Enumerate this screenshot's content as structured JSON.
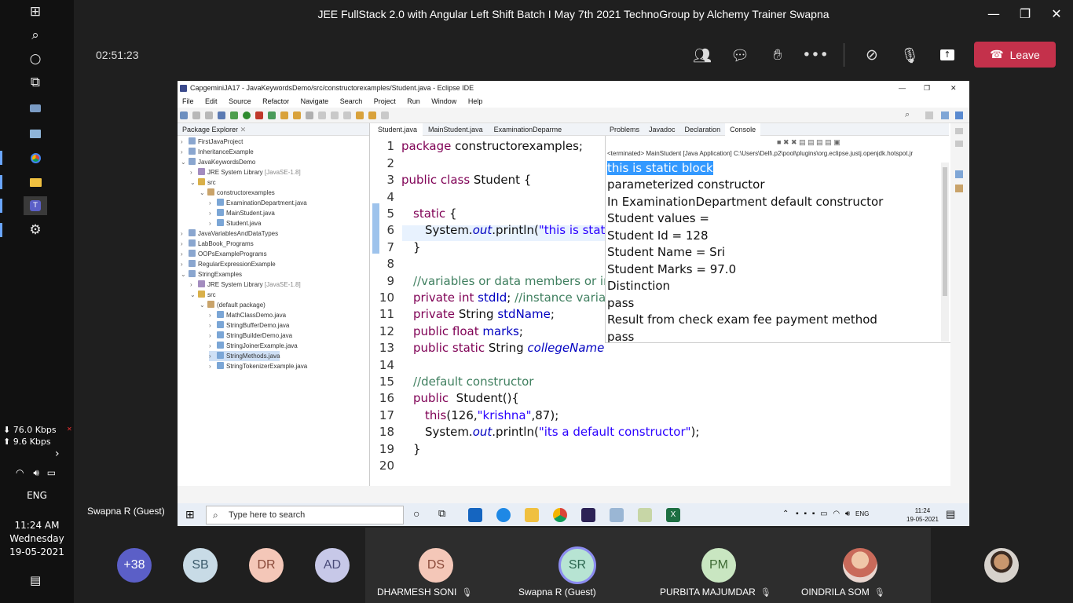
{
  "teams": {
    "title": "JEE FullStack 2.0 with Angular Left Shift Batch I May 7th 2021 TechnoGroup by Alchemy Trainer Swapna",
    "timer": "02:51:23",
    "leave_label": "Leave",
    "presenter": "Swapna R (Guest)",
    "accent": "#c4314b"
  },
  "system": {
    "net_down": "⬇ 76.0 Kbps",
    "net_up": "⬆ 9.6 Kbps",
    "language": "ENG",
    "time": "11:24 AM",
    "day": "Wednesday",
    "date": "19-05-2021"
  },
  "eclipse": {
    "title": "CapgeminiJA17 - JavaKeywordsDemo/src/constructorexamples/Student.java - Eclipse IDE",
    "menu": [
      "File",
      "Edit",
      "Source",
      "Refactor",
      "Navigate",
      "Search",
      "Project",
      "Run",
      "Window",
      "Help"
    ],
    "package_explorer_tab": "Package Explorer",
    "tree": [
      {
        "label": "FirstJavaProject"
      },
      {
        "label": "InheritanceExample"
      },
      {
        "label": "JavaKeywordsDemo"
      },
      {
        "label": "JRE System Library",
        "dim": "[JavaSE-1.8]"
      },
      {
        "label": "src"
      },
      {
        "label": "constructorexamples"
      },
      {
        "label": "ExaminationDepartment.java"
      },
      {
        "label": "MainStudent.java"
      },
      {
        "label": "Student.java"
      },
      {
        "label": "JavaVariablesAndDataTypes"
      },
      {
        "label": "LabBook_Programs"
      },
      {
        "label": "OOPsExamplePrograms"
      },
      {
        "label": "RegularExpressionExample"
      },
      {
        "label": "StringExamples"
      },
      {
        "label": "JRE System Library",
        "dim": "[JavaSE-1.8]"
      },
      {
        "label": "src"
      },
      {
        "label": "(default package)"
      },
      {
        "label": "MathClassDemo.java"
      },
      {
        "label": "StringBufferDemo.java"
      },
      {
        "label": "StringBuilderDemo.java"
      },
      {
        "label": "StringJoinerExample.java"
      },
      {
        "label": "StringMethods.java"
      },
      {
        "label": "StringTokenizerExample.java"
      }
    ],
    "editor_tabs": [
      "Student.java",
      "MainStudent.java",
      "ExaminationDeparme"
    ],
    "view_tabs": [
      "Problems",
      "Javadoc",
      "Declaration",
      "Console"
    ],
    "console_header": "<terminated> MainStudent [Java Application] C:\\Users\\Dell\\.p2\\pool\\plugins\\org.eclipse.justj.openjdk.hotspot.jr",
    "console_lines": [
      "this is static block",
      "parameterized constructor",
      "In ExaminationDepartment default constructor",
      "Student values =",
      "Student Id = 128",
      "Student Name = Sri",
      "Student Marks = 97.0",
      "Distinction",
      "pass",
      "Result from check exam fee payment method",
      "pass"
    ],
    "line_numbers": [
      "1",
      "2",
      "3",
      "4",
      "5",
      "6",
      "7",
      "8",
      "9",
      "10",
      "11",
      "12",
      "13",
      "14",
      "15",
      "16",
      "17",
      "18",
      "19",
      "20"
    ],
    "code": {
      "l1_kw": "package",
      "l1_rest": " constructorexamples;",
      "l3_kw": "public class",
      "l3_rest": " Student {",
      "l5_kw": "static",
      "l5_rest": " {",
      "l6_a": "System.",
      "l6_b": "out",
      "l6_c": ".println(",
      "l6_d": "\"this is stat",
      "l7": "}",
      "l9": "//variables or data members or in",
      "l10_kw": "private int",
      "l10_f": " stdId",
      "l10_p": ";",
      "l10_c": " //instance varia",
      "l11_kw": "private",
      "l11_t": " String",
      "l11_f": " stdName",
      "l11_p": ";",
      "l12_kw": "public float",
      "l12_f": " marks",
      "l12_p": ";",
      "l13_kw": "public static",
      "l13_t": " String ",
      "l13_f": "collegeName",
      "l15": "//default constructor",
      "l16_kw": "public",
      "l16_rest": "  Student(){",
      "l17_kw": "this",
      "l17_a": "(126,",
      "l17_s": "\"krishna\"",
      "l17_b": ",87);",
      "l18_a": "System.",
      "l18_b": "out",
      "l18_c": ".println(",
      "l18_s": "\"its a default constructor\"",
      "l18_d": ");",
      "l19": "}"
    }
  },
  "windows_taskbar": {
    "search_placeholder": "Type here to search",
    "lang": "ENG",
    "time": "11:24",
    "date": "19-05-2021"
  },
  "participants": [
    {
      "initials": "+38",
      "color": "#5b5fc7"
    },
    {
      "initials": "SB",
      "color": "#c8dbe6"
    },
    {
      "initials": "DR",
      "color": "#f4c7b8"
    },
    {
      "initials": "AD",
      "color": "#c7c8e8"
    },
    {
      "initials": "DS",
      "name": "DHARMESH SONI",
      "color": "#f4c7b8"
    },
    {
      "initials": "SR",
      "name": "Swapna R (Guest)",
      "color": "#b7e4d3"
    },
    {
      "initials": "PM",
      "name": "PURBITA MAJUMDAR",
      "color": "#c9e6c1"
    },
    {
      "name": "OINDRILA SOM"
    }
  ]
}
